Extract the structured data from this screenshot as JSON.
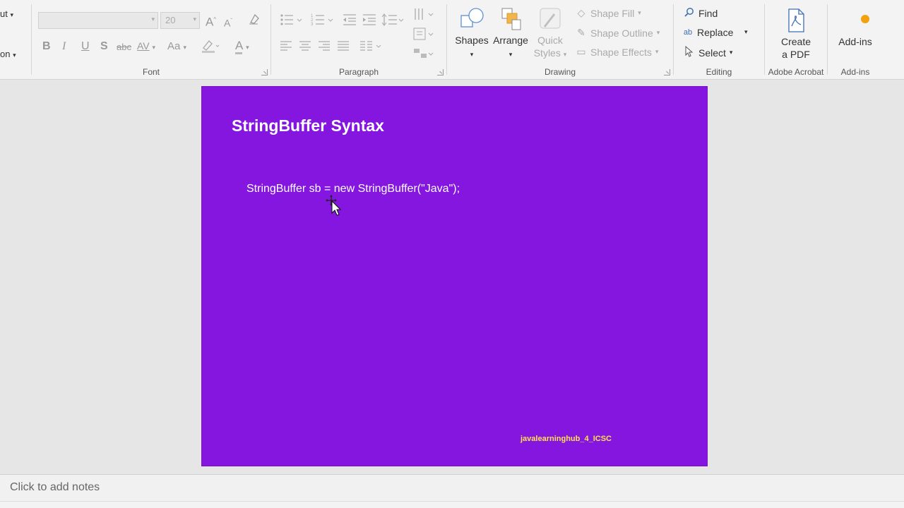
{
  "clipboard": {
    "cut_label": "ut",
    "layout_label": "on"
  },
  "font": {
    "size_value": "20",
    "group_label": "Font",
    "bold": "B",
    "italic": "I",
    "underline": "U",
    "strike_s": "S",
    "strike": "abc",
    "spacing": "AV",
    "case": "Aa",
    "color_a": "A",
    "grow": "A",
    "shrink": "A"
  },
  "paragraph": {
    "group_label": "Paragraph"
  },
  "drawing": {
    "group_label": "Drawing",
    "shapes_label": "Shapes",
    "arrange_label": "Arrange",
    "quick_styles_line1": "Quick",
    "quick_styles_line2": "Styles",
    "shape_fill": "Shape Fill",
    "shape_outline": "Shape Outline",
    "shape_effects": "Shape Effects"
  },
  "editing": {
    "group_label": "Editing",
    "find": "Find",
    "replace": "Replace",
    "select": "Select",
    "replace_glyph": "ab"
  },
  "acrobat": {
    "group_label": "Adobe Acrobat",
    "create_line1": "Create",
    "create_line2": "a PDF"
  },
  "addins": {
    "group_label": "Add-ins",
    "label": "Add-ins"
  },
  "slide": {
    "title": "StringBuffer Syntax",
    "code": "StringBuffer sb = new StringBuffer(\"Java\");",
    "footer": "javalearninghub_4_ICSC",
    "background": "#8516df",
    "footer_color": "#ffe14a"
  },
  "notes": {
    "placeholder": "Click to add notes"
  }
}
